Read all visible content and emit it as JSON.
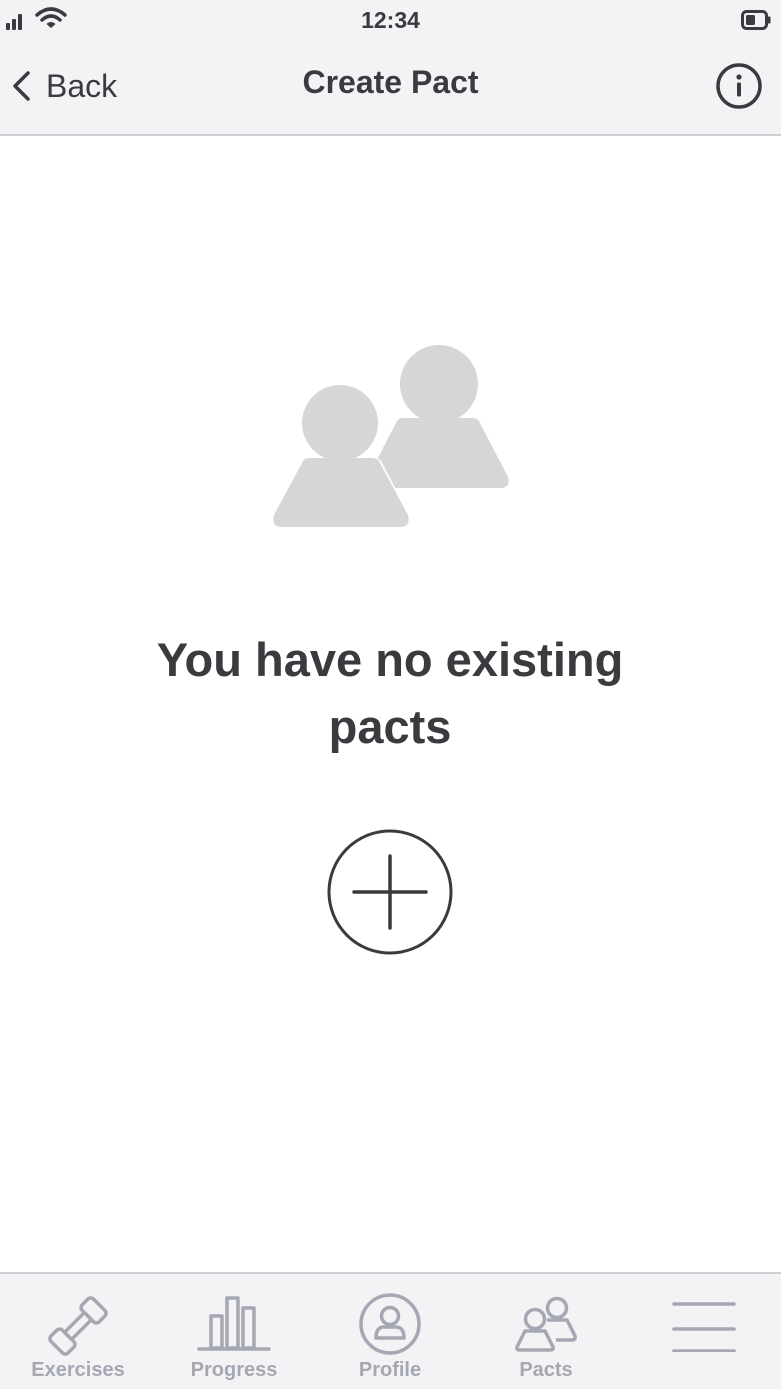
{
  "status_bar": {
    "time": "12:34",
    "signal_icon": "signal-icon",
    "wifi_icon": "wifi-icon",
    "battery_icon": "battery-icon"
  },
  "nav": {
    "back_label": "Back",
    "title": "Create Pact",
    "info_icon": "info-icon"
  },
  "empty_state": {
    "illustration_icon": "people-icon",
    "message": "You have no existing pacts",
    "add_icon": "plus-circle-icon"
  },
  "tabs": [
    {
      "label": "Exercises",
      "icon": "dumbbell-icon"
    },
    {
      "label": "Progress",
      "icon": "bar-chart-icon"
    },
    {
      "label": "Profile",
      "icon": "profile-icon"
    },
    {
      "label": "Pacts",
      "icon": "people-icon"
    },
    {
      "label": "",
      "icon": "menu-icon"
    }
  ],
  "colors": {
    "text": "#3a3a3f",
    "bar_background": "#f3f3f5",
    "illustration_gray": "#d6d6d6",
    "tab_inactive": "#a5a8b3"
  }
}
